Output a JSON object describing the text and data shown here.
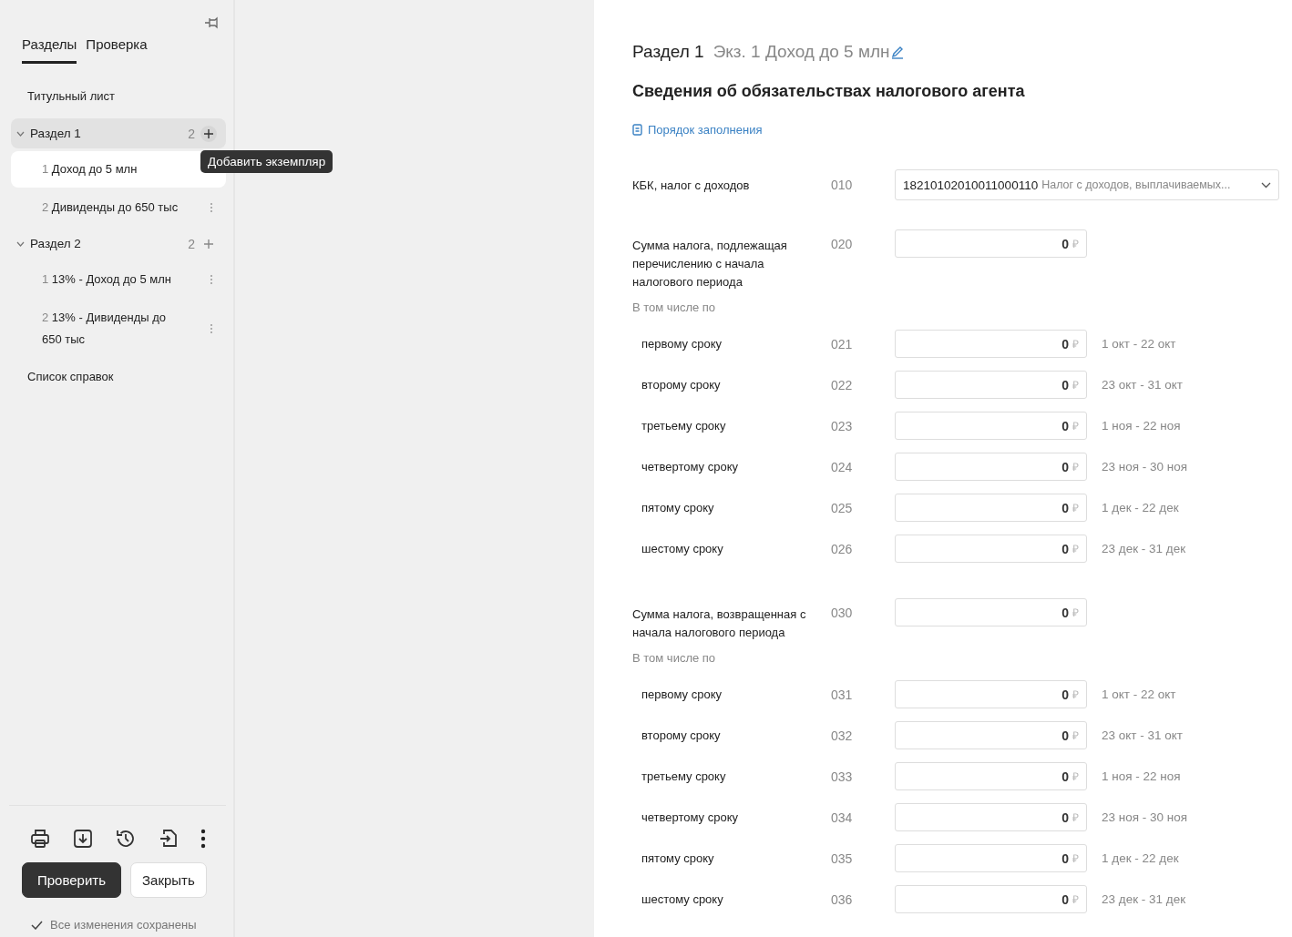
{
  "sidebar": {
    "tabs": [
      {
        "label": "Разделы",
        "selected": true
      },
      {
        "label": "Проверка",
        "selected": false
      }
    ],
    "items": [
      {
        "kind": "page",
        "label": "Титульный лист"
      },
      {
        "kind": "section",
        "label": "Раздел 1",
        "count": "2",
        "expanded": true,
        "highlighted": true,
        "children": [
          {
            "number": "1",
            "label": "Доход до 5 млн",
            "selected": true,
            "menu_visible": false
          },
          {
            "number": "2",
            "label": "Дивиденды до 650 тыс",
            "selected": false,
            "menu_visible": true
          }
        ]
      },
      {
        "kind": "section",
        "label": "Раздел 2",
        "count": "2",
        "expanded": true,
        "highlighted": false,
        "children": [
          {
            "number": "1",
            "label": "13% - Доход до 5 млн",
            "selected": false,
            "menu_visible": true
          },
          {
            "number": "2",
            "label": "13% - Дивиденды до 650 тыс",
            "selected": false,
            "menu_visible": true
          }
        ]
      },
      {
        "kind": "page",
        "label": "Список справок"
      }
    ],
    "tooltip": "Добавить экземпляр",
    "buttons": [
      {
        "label": "Проверить",
        "kind": "primary"
      },
      {
        "label": "Закрыть",
        "kind": "secondary"
      }
    ],
    "status": "Все изменения сохранены"
  },
  "main": {
    "section": "Раздел 1",
    "instance": "Экз. 1 Доход до 5 млн",
    "title": "Сведения об обязательствах налогового агента",
    "link": "Порядок заполнения",
    "kbk": {
      "label": "КБК, налог с доходов",
      "code": "010",
      "value": "18210102010011000110",
      "description": "Налог с доходов, выплачиваемых..."
    },
    "groups": [
      {
        "label": "Сумма налога, подлежащая перечислению с начала налогового периода",
        "code": "020",
        "value": "0",
        "currency": "₽",
        "subtitle": "В том числе по",
        "rows": [
          {
            "label": "первому сроку",
            "code": "021",
            "value": "0",
            "currency": "₽",
            "period": "1 окт - 22 окт"
          },
          {
            "label": "второму сроку",
            "code": "022",
            "value": "0",
            "currency": "₽",
            "period": "23 окт - 31 окт"
          },
          {
            "label": "третьему сроку",
            "code": "023",
            "value": "0",
            "currency": "₽",
            "period": "1 ноя - 22 ноя"
          },
          {
            "label": "четвертому сроку",
            "code": "024",
            "value": "0",
            "currency": "₽",
            "period": "23 ноя - 30 ноя"
          },
          {
            "label": "пятому сроку",
            "code": "025",
            "value": "0",
            "currency": "₽",
            "period": "1 дек - 22 дек"
          },
          {
            "label": "шестому сроку",
            "code": "026",
            "value": "0",
            "currency": "₽",
            "period": "23 дек - 31 дек"
          }
        ]
      },
      {
        "label": "Сумма налога, возвращенная с начала налогового периода",
        "code": "030",
        "value": "0",
        "currency": "₽",
        "subtitle": "В том числе по",
        "rows": [
          {
            "label": "первому сроку",
            "code": "031",
            "value": "0",
            "currency": "₽",
            "period": "1 окт - 22 окт"
          },
          {
            "label": "второму сроку",
            "code": "032",
            "value": "0",
            "currency": "₽",
            "period": "23 окт - 31 окт"
          },
          {
            "label": "третьему сроку",
            "code": "033",
            "value": "0",
            "currency": "₽",
            "period": "1 ноя - 22 ноя"
          },
          {
            "label": "четвертому сроку",
            "code": "034",
            "value": "0",
            "currency": "₽",
            "period": "23 ноя - 30 ноя"
          },
          {
            "label": "пятому сроку",
            "code": "035",
            "value": "0",
            "currency": "₽",
            "period": "1 дек - 22 дек"
          },
          {
            "label": "шестому сроку",
            "code": "036",
            "value": "0",
            "currency": "₽",
            "period": "23 дек - 31 дек"
          }
        ]
      }
    ]
  }
}
